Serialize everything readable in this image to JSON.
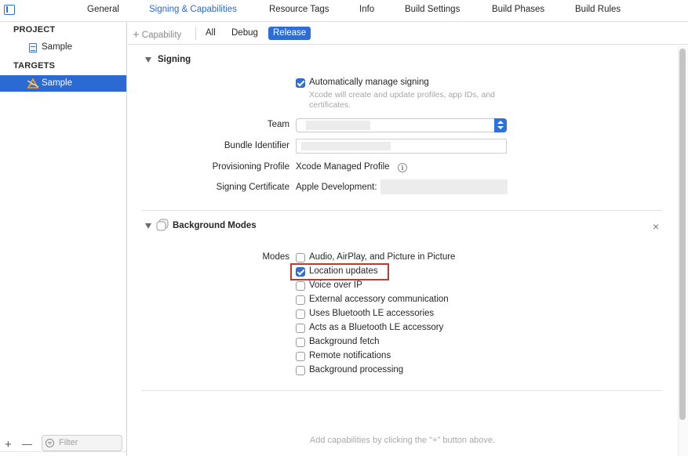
{
  "tabs": [
    {
      "label": "General",
      "active": false
    },
    {
      "label": "Signing & Capabilities",
      "active": true
    },
    {
      "label": "Resource Tags",
      "active": false
    },
    {
      "label": "Info",
      "active": false
    },
    {
      "label": "Build Settings",
      "active": false
    },
    {
      "label": "Build Phases",
      "active": false
    },
    {
      "label": "Build Rules",
      "active": false
    }
  ],
  "navigator": {
    "project_heading": "PROJECT",
    "project_item": "Sample",
    "targets_heading": "TARGETS",
    "target_item": "Sample",
    "add_symbol": "+",
    "remove_symbol": "—",
    "filter_placeholder": "Filter"
  },
  "toolbar": {
    "add_capability": "Capability",
    "add_symbol": "+",
    "filters": [
      "All",
      "Debug",
      "Release"
    ],
    "active_filter": "Release"
  },
  "signing": {
    "title": "Signing",
    "auto_manage_label": "Automatically manage signing",
    "auto_manage_checked": true,
    "auto_manage_help": "Xcode will create and update profiles, app IDs, and certificates.",
    "team_label": "Team",
    "team_value": "",
    "bundle_label": "Bundle Identifier",
    "bundle_value": "",
    "profile_label": "Provisioning Profile",
    "profile_value": "Xcode Managed Profile",
    "profile_info_symbol": "i",
    "certificate_label": "Signing Certificate",
    "certificate_value": "Apple Development:"
  },
  "background_modes": {
    "title": "Background Modes",
    "close_symbol": "×",
    "modes_label": "Modes",
    "options": [
      {
        "label": "Audio, AirPlay, and Picture in Picture",
        "checked": false
      },
      {
        "label": "Location updates",
        "checked": true
      },
      {
        "label": "Voice over IP",
        "checked": false
      },
      {
        "label": "External accessory communication",
        "checked": false
      },
      {
        "label": "Uses Bluetooth LE accessories",
        "checked": false
      },
      {
        "label": "Acts as a Bluetooth LE accessory",
        "checked": false
      },
      {
        "label": "Background fetch",
        "checked": false
      },
      {
        "label": "Remote notifications",
        "checked": false
      },
      {
        "label": "Background processing",
        "checked": false
      }
    ],
    "highlighted_option": "Location updates",
    "highlight_color": "#c0392b"
  },
  "footer_hint": "Add capabilities by clicking the \"+\" button above.",
  "colors": {
    "accent": "#2e6cd6",
    "selection": "#2b69d3"
  }
}
